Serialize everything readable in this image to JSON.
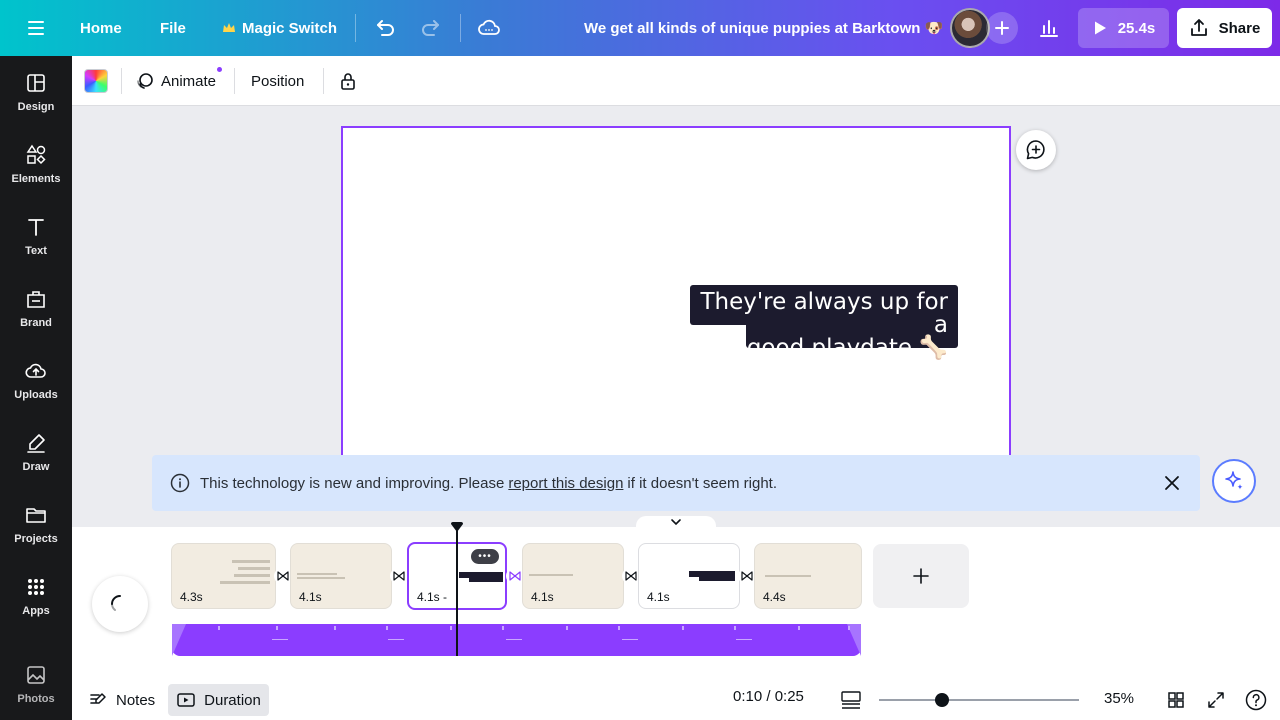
{
  "header": {
    "home": "Home",
    "file": "File",
    "magic_switch": "Magic Switch",
    "doc_title": "We get all kinds of unique puppies at Barktown 🐶",
    "play_duration": "25.4s",
    "share": "Share"
  },
  "sidebar": {
    "items": [
      {
        "label": "Design",
        "icon": "layout-icon"
      },
      {
        "label": "Elements",
        "icon": "shapes-icon"
      },
      {
        "label": "Text",
        "icon": "text-icon"
      },
      {
        "label": "Brand",
        "icon": "brand-icon"
      },
      {
        "label": "Uploads",
        "icon": "cloud-upload-icon"
      },
      {
        "label": "Draw",
        "icon": "pen-icon"
      },
      {
        "label": "Projects",
        "icon": "folder-icon"
      },
      {
        "label": "Apps",
        "icon": "grid-icon"
      },
      {
        "label": "Photos",
        "icon": "image-icon"
      }
    ]
  },
  "toolbar": {
    "animate": "Animate",
    "position": "Position"
  },
  "canvas": {
    "caption_line1": "They're always up for a",
    "caption_line2": "good playdate 🦴"
  },
  "notice": {
    "before": "This technology is new and improving. Please",
    "link": "report this design",
    "after": "if it doesn't seem right."
  },
  "timeline": {
    "clips": [
      {
        "duration": "4.3s"
      },
      {
        "duration": "4.1s"
      },
      {
        "duration": "4.1s -"
      },
      {
        "duration": "4.1s"
      },
      {
        "duration": "4.1s"
      },
      {
        "duration": "4.4s"
      }
    ]
  },
  "footer": {
    "notes": "Notes",
    "duration": "Duration",
    "time": "0:10 / 0:25",
    "zoom": "35%"
  },
  "colors": {
    "accent": "#8b3dff",
    "sidebar_bg": "#18191b",
    "notice_bg": "#d7e6fd"
  }
}
